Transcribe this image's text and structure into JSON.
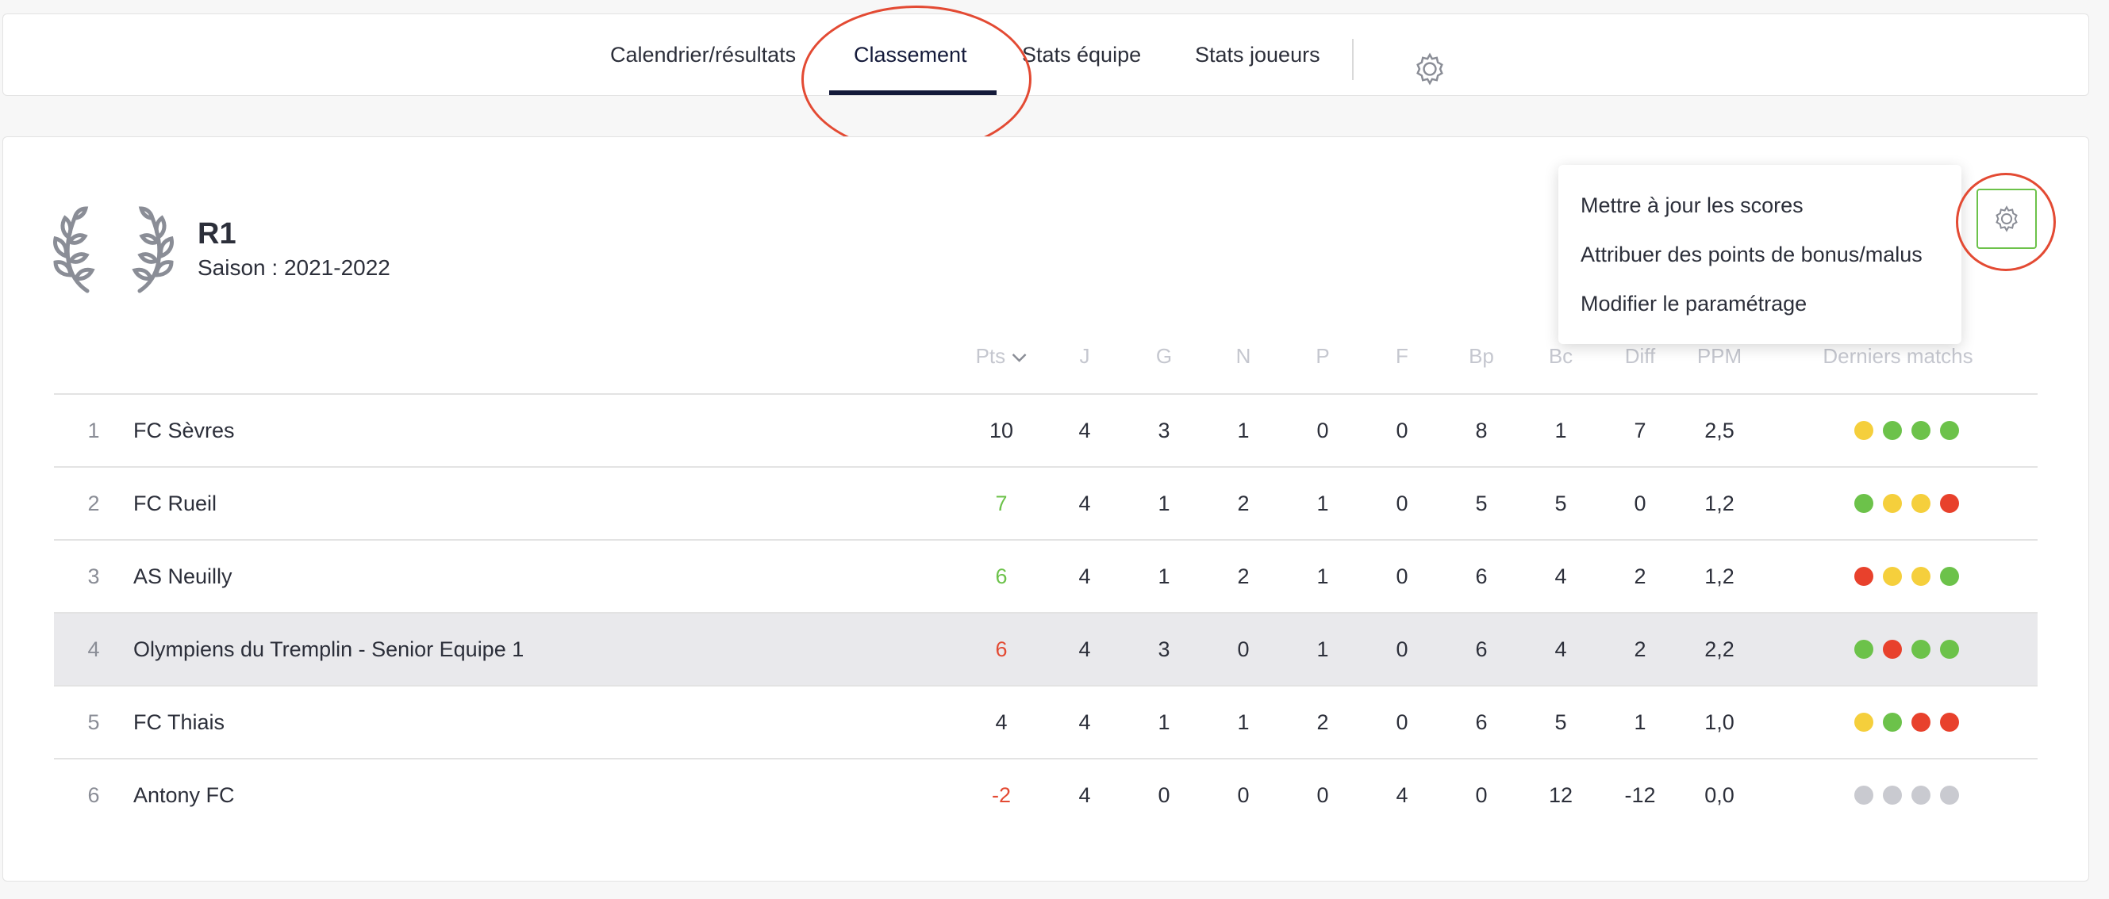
{
  "nav": {
    "tabs": [
      {
        "label": "Calendrier/résultats"
      },
      {
        "label": "Classement",
        "active": true
      },
      {
        "label": "Stats équipe"
      },
      {
        "label": "Stats joueurs"
      }
    ],
    "settings_icon": "gear-icon"
  },
  "competition": {
    "name": "R1",
    "season": "Saison : 2021-2022",
    "icon": "laurel-icon"
  },
  "dropdown": {
    "items": [
      {
        "label": "Mettre à jour les scores"
      },
      {
        "label": "Attribuer des points de bonus/malus"
      },
      {
        "label": "Modifier le paramétrage"
      }
    ]
  },
  "settings_button_icon": "gear-icon",
  "table": {
    "headers": {
      "pts": "Pts",
      "j": "J",
      "g": "G",
      "n": "N",
      "p": "P",
      "f": "F",
      "bp": "Bp",
      "bc": "Bc",
      "diff": "Diff",
      "ppm": "PPM",
      "last": "Derniers matchs"
    },
    "sort_icon": "chevron-down-icon",
    "rows": [
      {
        "rank": "1",
        "team": "FC Sèvres",
        "pts": "10",
        "j": "4",
        "g": "3",
        "n": "1",
        "p": "0",
        "f": "0",
        "bp": "8",
        "bc": "1",
        "diff": "7",
        "ppm": "2,5",
        "pts_color": "#2c2f3a",
        "highlight": false,
        "last": [
          "draw",
          "win",
          "win",
          "win"
        ]
      },
      {
        "rank": "2",
        "team": "FC Rueil",
        "pts": "7",
        "j": "4",
        "g": "1",
        "n": "2",
        "p": "1",
        "f": "0",
        "bp": "5",
        "bc": "5",
        "diff": "0",
        "ppm": "1,2",
        "pts_color": "#6cc24a",
        "highlight": false,
        "last": [
          "win",
          "draw",
          "draw",
          "loss"
        ]
      },
      {
        "rank": "3",
        "team": "AS Neuilly",
        "pts": "6",
        "j": "4",
        "g": "1",
        "n": "2",
        "p": "1",
        "f": "0",
        "bp": "6",
        "bc": "4",
        "diff": "2",
        "ppm": "1,2",
        "pts_color": "#6cc24a",
        "highlight": false,
        "last": [
          "loss",
          "draw",
          "draw",
          "win"
        ]
      },
      {
        "rank": "4",
        "team": "Olympiens du Tremplin - Senior Equipe 1",
        "pts": "6",
        "j": "4",
        "g": "3",
        "n": "0",
        "p": "1",
        "f": "0",
        "bp": "6",
        "bc": "4",
        "diff": "2",
        "ppm": "2,2",
        "pts_color": "#e34a33",
        "highlight": true,
        "last": [
          "win",
          "loss",
          "win",
          "win"
        ]
      },
      {
        "rank": "5",
        "team": "FC Thiais",
        "pts": "4",
        "j": "4",
        "g": "1",
        "n": "1",
        "p": "2",
        "f": "0",
        "bp": "6",
        "bc": "5",
        "diff": "1",
        "ppm": "1,0",
        "pts_color": "#2c2f3a",
        "highlight": false,
        "last": [
          "draw",
          "win",
          "loss",
          "loss"
        ]
      },
      {
        "rank": "6",
        "team": "Antony FC",
        "pts": "-2",
        "j": "4",
        "g": "0",
        "n": "0",
        "p": "0",
        "f": "4",
        "bp": "0",
        "bc": "12",
        "diff": "-12",
        "ppm": "0,0",
        "pts_color": "#e34a33",
        "highlight": false,
        "last": [
          "none",
          "none",
          "none",
          "none"
        ]
      }
    ],
    "result_colors": {
      "win": "#6cc24a",
      "draw": "#f5cf3c",
      "loss": "#e8412c",
      "none": "#c9cad0"
    }
  },
  "annotation_color": "#e34a33",
  "accent_color": "#141a3a"
}
